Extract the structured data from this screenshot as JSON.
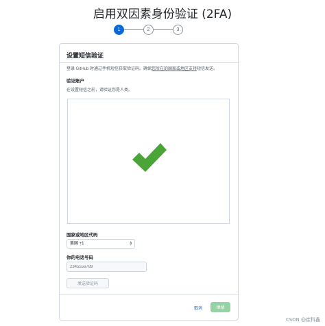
{
  "page": {
    "title": "启用双因素身份验证 (2FA)"
  },
  "stepper": {
    "steps": [
      "1",
      "2",
      "3"
    ],
    "active_step": 1,
    "active_color": "#0969da"
  },
  "sms_setup": {
    "title": "设置短信验证",
    "description_prefix": "登录 GitHub 时通过手机短信获取验证码。确保",
    "description_link": "您所在的国家或地区支持",
    "description_suffix": "短信发送。",
    "verify_label": "验证账户",
    "verify_hint": "在设置短信之前，请验证您是人类。",
    "captcha_status_icon": "checkmark-icon",
    "captcha_check_color": "#4aa437",
    "country_label": "国家或地区代码",
    "country_value": "美国 +1",
    "phone_label": "你的电话号码",
    "phone_placeholder": "2345556789",
    "send_code_label": "发送验证码",
    "cancel_label": "取消",
    "submit_label": "继续",
    "submit_color": "#94d3a2"
  },
  "watermark": "CSDN @崔科鑫"
}
